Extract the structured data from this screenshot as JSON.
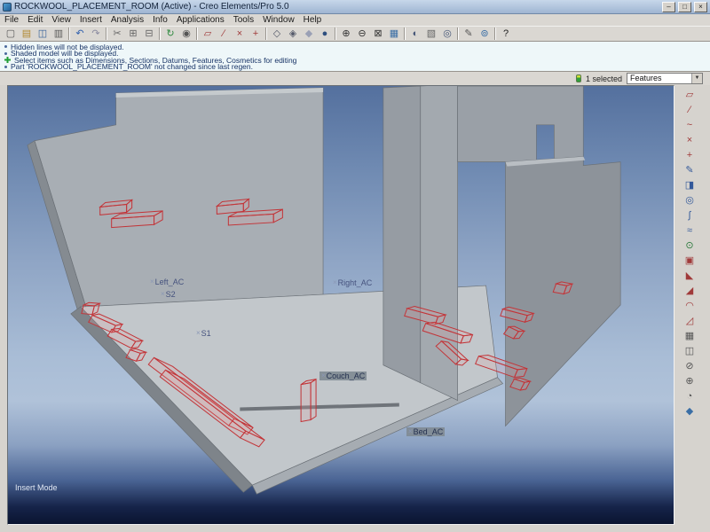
{
  "window": {
    "title": "ROCKWOOL_PLACEMENT_ROOM (Active) - Creo Elements/Pro 5.0",
    "controls": {
      "minimize": "–",
      "maximize": "□",
      "close": "×"
    }
  },
  "menu": {
    "items": [
      "File",
      "Edit",
      "View",
      "Insert",
      "Analysis",
      "Info",
      "Applications",
      "Tools",
      "Window",
      "Help"
    ]
  },
  "toolbar": {
    "items": [
      {
        "type": "btn",
        "name": "new-file-button",
        "glyph": "▢",
        "color": "#5a5a5a",
        "i": "true"
      },
      {
        "type": "btn",
        "name": "open-file-button",
        "glyph": "▤",
        "color": "#b08830",
        "i": "true"
      },
      {
        "type": "btn",
        "name": "save-button",
        "glyph": "◫",
        "color": "#34609a",
        "i": "true"
      },
      {
        "type": "btn",
        "name": "print-button",
        "glyph": "▥",
        "color": "#5a5a5a",
        "i": "true"
      },
      {
        "type": "sep",
        "name": "toolbar-separator",
        "glyph": "",
        "color": "",
        "i": "false"
      },
      {
        "type": "btn",
        "name": "undo-button",
        "glyph": "↶",
        "color": "#2f5fae",
        "i": "true"
      },
      {
        "type": "btn",
        "name": "redo-button",
        "glyph": "↷",
        "color": "#8a8aa0",
        "i": "true"
      },
      {
        "type": "sep",
        "name": "toolbar-separator",
        "glyph": "",
        "color": "",
        "i": "false"
      },
      {
        "type": "btn",
        "name": "cut-button",
        "glyph": "✂",
        "color": "#666666",
        "i": "true"
      },
      {
        "type": "btn",
        "name": "copy-button",
        "glyph": "⊞",
        "color": "#666666",
        "i": "true"
      },
      {
        "type": "btn",
        "name": "paste-button",
        "glyph": "⊟",
        "color": "#666666",
        "i": "true"
      },
      {
        "type": "sep",
        "name": "toolbar-separator",
        "glyph": "",
        "color": "",
        "i": "false"
      },
      {
        "type": "btn",
        "name": "regenerate-button",
        "glyph": "↻",
        "color": "#2d8a3e",
        "i": "true"
      },
      {
        "type": "btn",
        "name": "find-button",
        "glyph": "◉",
        "color": "#555555",
        "i": "true"
      },
      {
        "type": "sep",
        "name": "toolbar-separator",
        "glyph": "",
        "color": "",
        "i": "false"
      },
      {
        "type": "btn",
        "name": "datum-planes-toggle",
        "glyph": "▱",
        "color": "#a03a3a",
        "i": "true"
      },
      {
        "type": "btn",
        "name": "datum-axes-toggle",
        "glyph": "∕",
        "color": "#a03a3a",
        "i": "true"
      },
      {
        "type": "btn",
        "name": "datum-points-toggle",
        "glyph": "×",
        "color": "#a03a3a",
        "i": "true"
      },
      {
        "type": "btn",
        "name": "csys-toggle",
        "glyph": "+",
        "color": "#a03a3a",
        "i": "true"
      },
      {
        "type": "sep",
        "name": "toolbar-separator",
        "glyph": "",
        "color": "",
        "i": "false"
      },
      {
        "type": "btn",
        "name": "wireframe-display-button",
        "glyph": "◇",
        "color": "#555a6a",
        "i": "true"
      },
      {
        "type": "btn",
        "name": "hidden-line-display-button",
        "glyph": "◈",
        "color": "#555a6a",
        "i": "true"
      },
      {
        "type": "btn",
        "name": "no-hidden-line-display-button",
        "glyph": "◆",
        "color": "#9aa0b5",
        "i": "true"
      },
      {
        "type": "btn",
        "name": "shaded-display-button",
        "glyph": "●",
        "color": "#2f4f7f",
        "i": "true"
      },
      {
        "type": "sep",
        "name": "toolbar-separator",
        "glyph": "",
        "color": "",
        "i": "false"
      },
      {
        "type": "btn",
        "name": "zoom-in-button",
        "glyph": "⊕",
        "color": "#333333",
        "i": "true"
      },
      {
        "type": "btn",
        "name": "zoom-out-button",
        "glyph": "⊖",
        "color": "#333333",
        "i": "true"
      },
      {
        "type": "btn",
        "name": "refit-button",
        "glyph": "⊠",
        "color": "#333333",
        "i": "true"
      },
      {
        "type": "btn",
        "name": "repaint-button",
        "glyph": "▦",
        "color": "#3a6ea5",
        "i": "true"
      },
      {
        "type": "sep",
        "name": "toolbar-separator",
        "glyph": "",
        "color": "",
        "i": "false"
      },
      {
        "type": "btn",
        "name": "saved-views-button",
        "glyph": "◐",
        "color": "#445577",
        "i": "true"
      },
      {
        "type": "btn",
        "name": "layers-button",
        "glyph": "▧",
        "color": "#666666",
        "i": "true"
      },
      {
        "type": "btn",
        "name": "view-manager-button",
        "glyph": "◎",
        "color": "#445577",
        "i": "true"
      },
      {
        "type": "sep",
        "name": "toolbar-separator",
        "glyph": "",
        "color": "",
        "i": "false"
      },
      {
        "type": "btn",
        "name": "annotations-button",
        "glyph": "✎",
        "color": "#555555",
        "i": "true"
      },
      {
        "type": "btn",
        "name": "spin-center-toggle",
        "glyph": "⊚",
        "color": "#3a6ea5",
        "i": "true"
      },
      {
        "type": "sep",
        "name": "toolbar-separator",
        "glyph": "",
        "color": "",
        "i": "false"
      },
      {
        "type": "btn",
        "name": "context-help-button",
        "glyph": "?",
        "color": "#222222",
        "i": "true"
      }
    ]
  },
  "messages": {
    "lines": [
      {
        "text": "Hidden lines will not be displayed."
      },
      {
        "text": "Shaded model will be displayed."
      },
      {
        "text": "Select items such as Dimensions, Sections, Datums, Features, Cosmetics for editing"
      },
      {
        "text": "Part 'ROCKWOOL_PLACEMENT_ROOM' not changed since last regen."
      }
    ]
  },
  "status": {
    "selected": "1 selected",
    "filter": "Features",
    "arrow": "▼"
  },
  "right_toolbar": {
    "items": [
      {
        "name": "datum-plane-tool",
        "glyph": "▱",
        "color": "#a03a3a"
      },
      {
        "name": "datum-axis-tool",
        "glyph": "∕",
        "color": "#a03a3a"
      },
      {
        "name": "datum-curve-tool",
        "glyph": "~",
        "color": "#a03a3a"
      },
      {
        "name": "datum-point-tool",
        "glyph": "×",
        "color": "#a03a3a"
      },
      {
        "name": "coordinate-system-tool",
        "glyph": "+",
        "color": "#a03a3a"
      },
      {
        "name": "sketch-tool",
        "glyph": "✎",
        "color": "#33599a"
      },
      {
        "name": "extrude-tool",
        "glyph": "◨",
        "color": "#33599a"
      },
      {
        "name": "revolve-tool",
        "glyph": "◎",
        "color": "#33599a"
      },
      {
        "name": "sweep-tool",
        "glyph": "∫",
        "color": "#33599a"
      },
      {
        "name": "blend-tool",
        "glyph": "≈",
        "color": "#33599a"
      },
      {
        "name": "hole-tool",
        "glyph": "⊙",
        "color": "#2d7a3e"
      },
      {
        "name": "shell-tool",
        "glyph": "▣",
        "color": "#a03a3a"
      },
      {
        "name": "rib-tool",
        "glyph": "◣",
        "color": "#a03a3a"
      },
      {
        "name": "draft-tool",
        "glyph": "◢",
        "color": "#a03a3a"
      },
      {
        "name": "round-tool",
        "glyph": "◠",
        "color": "#a03a3a"
      },
      {
        "name": "chamfer-tool",
        "glyph": "◿",
        "color": "#a03a3a"
      },
      {
        "name": "pattern-tool",
        "glyph": "▦",
        "color": "#555555"
      },
      {
        "name": "mirror-tool",
        "glyph": "◫",
        "color": "#555555"
      },
      {
        "name": "trim-tool",
        "glyph": "⊘",
        "color": "#555555"
      },
      {
        "name": "merge-tool",
        "glyph": "⊕",
        "color": "#555555"
      },
      {
        "name": "wrap-tool",
        "glyph": "◔",
        "color": "#555555"
      },
      {
        "name": "style-tool",
        "glyph": "◆",
        "color": "#3a6ea5"
      }
    ]
  },
  "viewport": {
    "insert_mode": "Insert Mode",
    "labels": {
      "left_ac": {
        "marker": "×",
        "text": "Left_AC"
      },
      "s2": {
        "marker": "×",
        "text": "S2"
      },
      "right_ac": {
        "marker": "×",
        "text": "Right_AC"
      },
      "s1": {
        "marker": "×",
        "text": "S1"
      },
      "couch_ac": {
        "marker": "×",
        "text": "Couch_AC"
      },
      "bed_ac": {
        "marker": "×",
        "text": "Bed_AC"
      }
    }
  }
}
